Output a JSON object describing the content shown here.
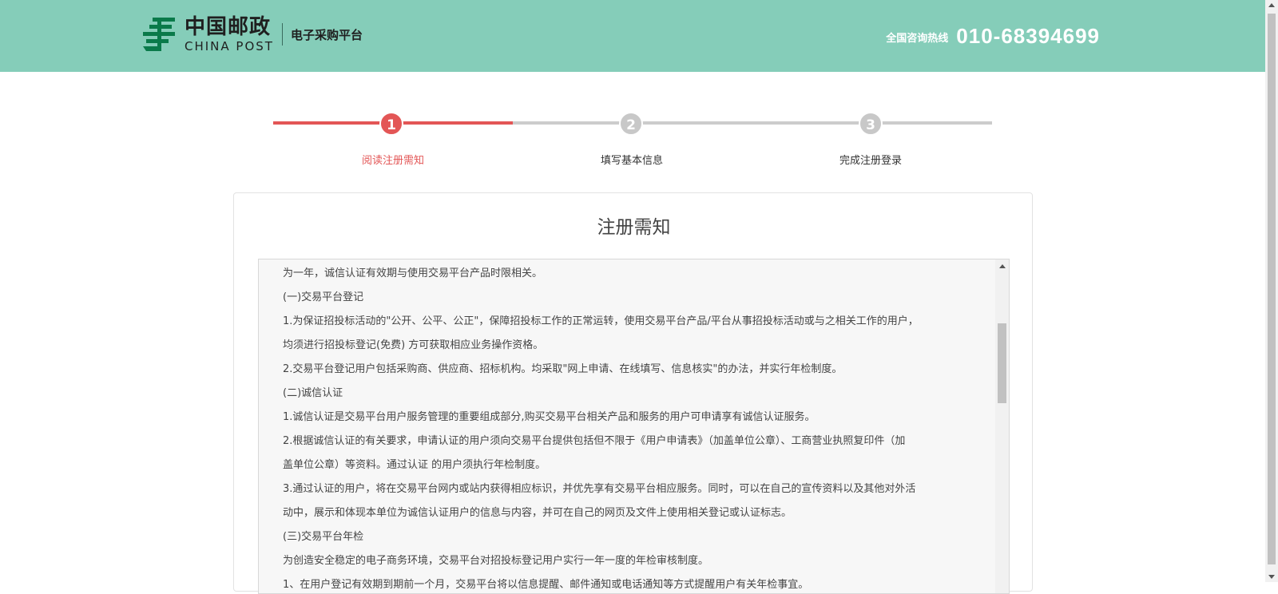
{
  "header": {
    "logo_cn": "中国邮政",
    "logo_en": "CHINA POST",
    "platform": "电子采购平台",
    "hotline_label": "全国咨询热线",
    "hotline_number": "010-68394699"
  },
  "steps": [
    {
      "number": "1",
      "label": "阅读注册需知",
      "active": true
    },
    {
      "number": "2",
      "label": "填写基本信息",
      "active": false
    },
    {
      "number": "3",
      "label": "完成注册登录",
      "active": false
    }
  ],
  "notice": {
    "title": "注册需知",
    "lines": [
      "为一年，诚信认证有效期与使用交易平台产品时限相关。",
      "(一)交易平台登记",
      "1.为保证招投标活动的\"公开、公平、公正\"，保障招投标工作的正常运转，使用交易平台产品/平台从事招投标活动或与之相关工作的用户，",
      "均须进行招投标登记(免费) 方可获取相应业务操作资格。",
      "2.交易平台登记用户包括采购商、供应商、招标机构。均采取\"网上申请、在线填写、信息核实\"的办法，并实行年检制度。",
      "(二)诚信认证",
      "1.诚信认证是交易平台用户服务管理的重要组成部分,购买交易平台相关产品和服务的用户可申请享有诚信认证服务。",
      "2.根据诚信认证的有关要求，申请认证的用户须向交易平台提供包括但不限于《用户申请表》（加盖单位公章）、工商营业执照复印件（加",
      "盖单位公章）等资料。通过认证 的用户须执行年检制度。",
      "3.通过认证的用户，将在交易平台网内或站内获得相应标识，并优先享有交易平台相应服务。同时，可以在自己的宣传资料以及其他对外活",
      "动中，展示和体现本单位为诚信认证用户的信息与内容，并可在自己的网页及文件上使用相关登记或认证标志。",
      "(三)交易平台年检",
      "为创造安全稳定的电子商务环境，交易平台对招投标登记用户实行一年一度的年检审核制度。",
      "1、在用户登记有效期到期前一个月，交易平台将以信息提醒、邮件通知或电话通知等方式提醒用户有关年检事宜。"
    ]
  },
  "colors": {
    "header_bg": "#85cdb9",
    "active": "#e35656",
    "inactive": "#cccccc"
  }
}
